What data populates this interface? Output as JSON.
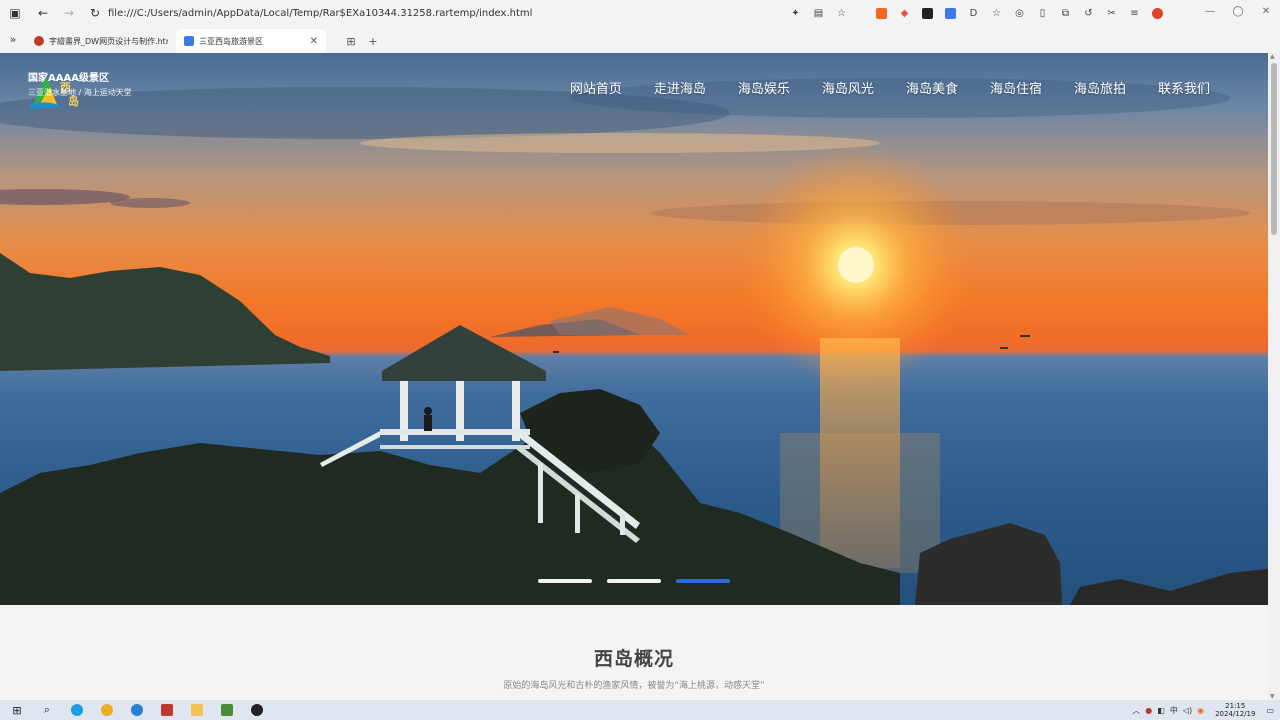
{
  "browser": {
    "address": "file:///C:/Users/admin/AppData/Local/Temp/Rar$EXa10344.31258.rartemp/index.html",
    "tabs": [
      {
        "title": "字繪畫界_DW网页设计与制作.html",
        "active": false
      },
      {
        "title": "三亚西岛旅游景区",
        "active": true
      }
    ]
  },
  "site": {
    "brand_title": "国家AAAA级景区",
    "brand_subtitle": "三亚潜水基地 / 海上运动天堂",
    "logo_text": "西岛",
    "nav": [
      "网站首页",
      "走进海岛",
      "海岛娱乐",
      "海岛风光",
      "海岛美食",
      "海岛住宿",
      "海岛旅拍",
      "联系我们"
    ],
    "carousel": {
      "count": 3,
      "active_index": 2
    }
  },
  "section": {
    "title": "西岛概况",
    "subtitle": "原始的海岛风光和古朴的渔家风情，被誉为“海上桃源，动感天堂”"
  },
  "taskbar": {
    "time": "21:15",
    "date": "2024/12/19"
  },
  "icons": {
    "back": "arrow-left-icon",
    "forward": "arrow-right-icon",
    "reload": "reload-icon",
    "star": "star-icon"
  },
  "colors": {
    "accent": "#2b6bd6",
    "sun": "#fff3b0"
  }
}
